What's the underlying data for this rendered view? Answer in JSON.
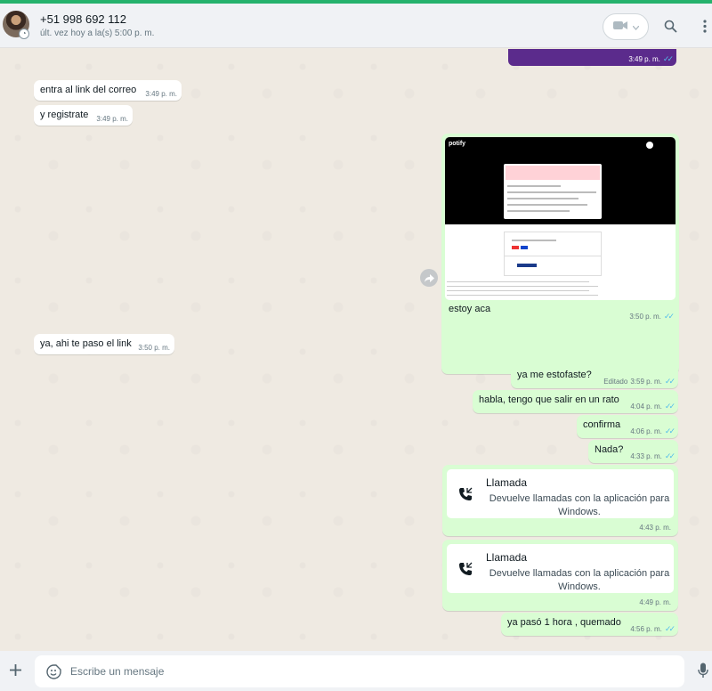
{
  "header": {
    "contact_name": "+51 998 692 112",
    "status": "últ. vez hoy a la(s) 5:00 p. m.",
    "video_icon": "video-camera-icon",
    "chevron_icon": "chevron-down-icon",
    "search_icon": "search-icon",
    "menu_icon": "more-vertical-icon"
  },
  "messages": [
    {
      "direction": "out",
      "type": "image",
      "time": "3:49 p. m.",
      "status": "read"
    },
    {
      "direction": "in",
      "text": "entra al link del correo",
      "time": "3:49 p. m."
    },
    {
      "direction": "in",
      "text": "y registrate",
      "time": "3:49 p. m."
    },
    {
      "direction": "out",
      "type": "image",
      "caption": "estoy aca",
      "time": "3:50 p. m.",
      "status": "read",
      "image_text": {
        "brand": "potify"
      }
    },
    {
      "direction": "in",
      "text": "ya, ahi te paso el link",
      "time": "3:50 p. m."
    },
    {
      "direction": "out",
      "text": "ya me estofaste?",
      "edited_label": "Editado",
      "time": "3:59 p. m.",
      "status": "read"
    },
    {
      "direction": "out",
      "text": "habla, tengo que salir en un rato",
      "time": "4:04 p. m.",
      "status": "read"
    },
    {
      "direction": "out",
      "text": "confirma",
      "time": "4:06 p. m.",
      "status": "read"
    },
    {
      "direction": "out",
      "text": "Nada?",
      "time": "4:33 p. m.",
      "status": "read"
    },
    {
      "direction": "out",
      "type": "call",
      "title": "Llamada",
      "description": "Devuelve llamadas con la aplicación para Windows.",
      "time": "4:43 p. m."
    },
    {
      "direction": "out",
      "type": "call",
      "title": "Llamada",
      "description": "Devuelve llamadas con la aplicación para Windows.",
      "time": "4:49 p. m."
    },
    {
      "direction": "out",
      "text": "ya pasó 1 hora , quemado",
      "time": "4:56 p. m.",
      "status": "read"
    }
  ],
  "composer": {
    "placeholder": "Escribe un mensaje",
    "attach_icon": "plus-icon",
    "emoji_icon": "sticker-icon",
    "mic_icon": "microphone-icon"
  },
  "colors": {
    "incoming_bubble": "#ffffff",
    "outgoing_bubble": "#d9fdd3",
    "read_ticks": "#53bdeb",
    "background": "#efeae2",
    "accent": "#25b26c"
  }
}
